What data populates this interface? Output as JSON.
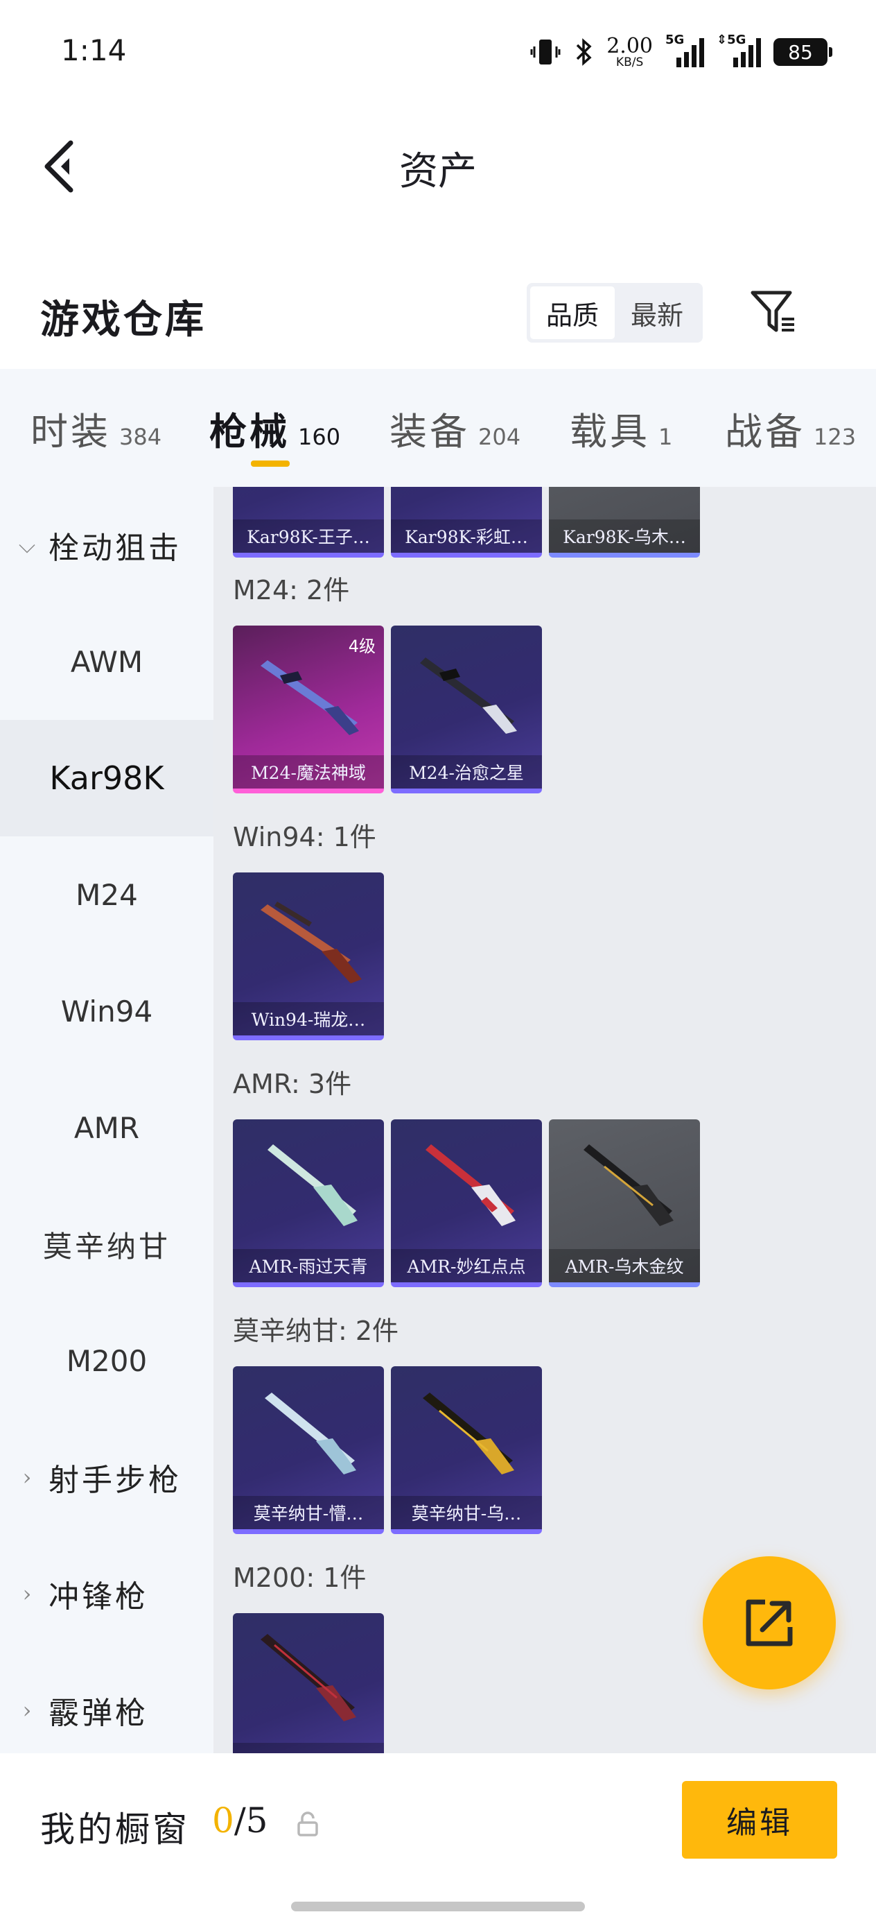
{
  "status": {
    "time": "1:14",
    "net_speed_value": "2.00",
    "net_speed_unit": "KB/S",
    "signal1_label": "5G",
    "signal2_label": "5G",
    "battery": "85"
  },
  "header": {
    "title": "资产"
  },
  "section": {
    "title": "游戏仓库",
    "sort_options": [
      "品质",
      "最新"
    ],
    "sort_active": "品质"
  },
  "tabs": [
    {
      "label": "时装",
      "count": "384"
    },
    {
      "label": "枪械",
      "count": "160",
      "active": true
    },
    {
      "label": "装备",
      "count": "204"
    },
    {
      "label": "载具",
      "count": "1"
    },
    {
      "label": "战备",
      "count": "123"
    }
  ],
  "sidebar": {
    "items": [
      {
        "label": "栓动狙击",
        "type": "category",
        "expanded": true
      },
      {
        "label": "AWM",
        "type": "sub"
      },
      {
        "label": "Kar98K",
        "type": "sub",
        "active": true
      },
      {
        "label": "M24",
        "type": "sub"
      },
      {
        "label": "Win94",
        "type": "sub"
      },
      {
        "label": "AMR",
        "type": "sub"
      },
      {
        "label": "莫辛纳甘",
        "type": "sub"
      },
      {
        "label": "M200",
        "type": "sub"
      },
      {
        "label": "射手步枪",
        "type": "category"
      },
      {
        "label": "冲锋枪",
        "type": "category"
      },
      {
        "label": "霰弹枪",
        "type": "category"
      }
    ]
  },
  "groups": [
    {
      "label": "",
      "items": [
        {
          "name": "Kar98K-王子…",
          "rarity": "purple"
        },
        {
          "name": "Kar98K-彩虹…",
          "rarity": "purple"
        },
        {
          "name": "Kar98K-乌木…",
          "rarity": "grey"
        }
      ]
    },
    {
      "label": "M24: 2件",
      "items": [
        {
          "name": "M24-魔法神域",
          "rarity": "pink",
          "level": "4级"
        },
        {
          "name": "M24-治愈之星",
          "rarity": "purple"
        }
      ]
    },
    {
      "label": "Win94: 1件",
      "items": [
        {
          "name": "Win94-瑞龙…",
          "rarity": "purple"
        }
      ]
    },
    {
      "label": "AMR: 3件",
      "items": [
        {
          "name": "AMR-雨过天青",
          "rarity": "purple"
        },
        {
          "name": "AMR-妙红点点",
          "rarity": "purple"
        },
        {
          "name": "AMR-乌木金纹",
          "rarity": "grey"
        }
      ]
    },
    {
      "label": "莫辛纳甘: 2件",
      "items": [
        {
          "name": "莫辛纳甘-懵…",
          "rarity": "purple"
        },
        {
          "name": "莫辛纳甘-乌…",
          "rarity": "purple"
        }
      ]
    },
    {
      "label": "M200: 1件",
      "items": [
        {
          "name": "",
          "rarity": "purple"
        }
      ]
    }
  ],
  "bottom": {
    "showcase_label": "我的橱窗",
    "showcase_current": "0",
    "showcase_total": "/5",
    "edit_label": "编辑"
  },
  "icons": {
    "back": "chevron-left-icon",
    "filter": "filter-icon",
    "share": "external-share-icon",
    "lock": "lock-icon"
  },
  "colors": {
    "accent": "#ffb80c",
    "tab_indicator": "#f3b300",
    "purple_rarity": "#7d6cff",
    "pink_rarity": "#ff5fd8"
  }
}
